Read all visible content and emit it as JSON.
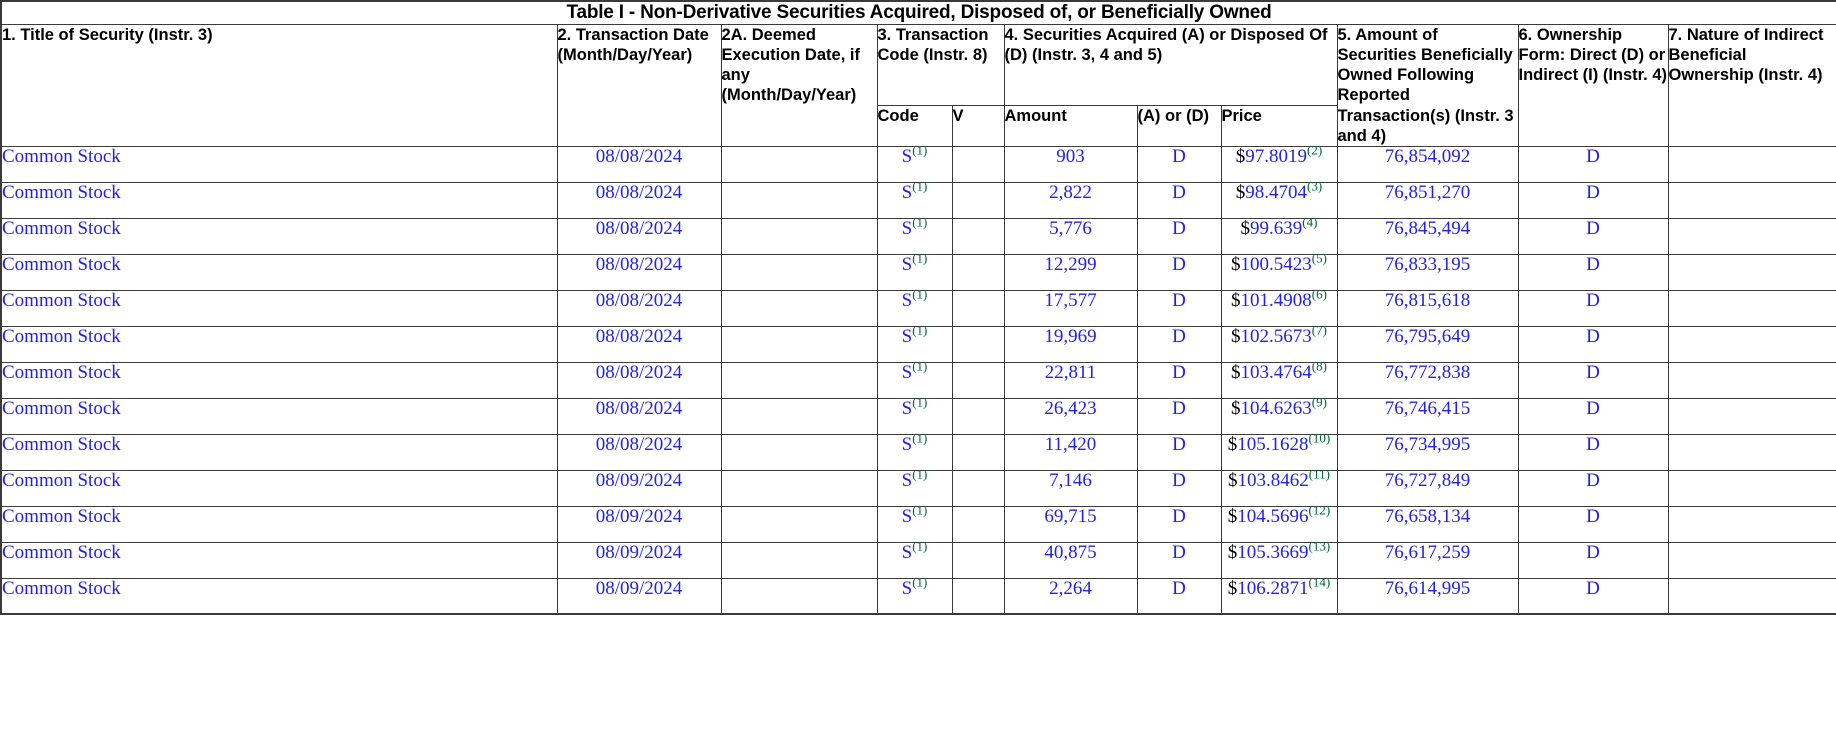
{
  "table": {
    "title": "Table I - Non-Derivative Securities Acquired, Disposed of, or Beneficially Owned",
    "headers": {
      "col1": "1. Title of Security (Instr. 3)",
      "col2": "2. Transaction Date (Month/Day/Year)",
      "col2a": "2A. Deemed Execution Date, if any (Month/Day/Year)",
      "col3": "3. Transaction Code (Instr. 8)",
      "col4": "4. Securities Acquired (A) or Disposed Of (D) (Instr. 3, 4 and 5)",
      "col5": "5. Amount of Securities Beneficially Owned Following Reported Transaction(s) (Instr. 3 and 4)",
      "col6": "6. Ownership Form: Direct (D) or Indirect (I) (Instr. 4)",
      "col7": "7. Nature of Indirect Beneficial Ownership (Instr. 4)"
    },
    "subheaders": {
      "code": "Code",
      "v": "V",
      "amount": "Amount",
      "ad": "(A) or (D)",
      "price": "Price"
    },
    "rows": [
      {
        "security": "Common Stock",
        "transaction_date": "08/08/2024",
        "deemed_execution_date": "",
        "code": "S",
        "code_footnote": "(1)",
        "v": "",
        "amount": "903",
        "ad": "D",
        "price_currency": "$",
        "price": "97.8019",
        "price_footnote": "(2)",
        "beneficially_owned": "76,854,092",
        "ownership_form": "D",
        "nature_indirect": ""
      },
      {
        "security": "Common Stock",
        "transaction_date": "08/08/2024",
        "deemed_execution_date": "",
        "code": "S",
        "code_footnote": "(1)",
        "v": "",
        "amount": "2,822",
        "ad": "D",
        "price_currency": "$",
        "price": "98.4704",
        "price_footnote": "(3)",
        "beneficially_owned": "76,851,270",
        "ownership_form": "D",
        "nature_indirect": ""
      },
      {
        "security": "Common Stock",
        "transaction_date": "08/08/2024",
        "deemed_execution_date": "",
        "code": "S",
        "code_footnote": "(1)",
        "v": "",
        "amount": "5,776",
        "ad": "D",
        "price_currency": "$",
        "price": "99.639",
        "price_footnote": "(4)",
        "beneficially_owned": "76,845,494",
        "ownership_form": "D",
        "nature_indirect": ""
      },
      {
        "security": "Common Stock",
        "transaction_date": "08/08/2024",
        "deemed_execution_date": "",
        "code": "S",
        "code_footnote": "(1)",
        "v": "",
        "amount": "12,299",
        "ad": "D",
        "price_currency": "$",
        "price": "100.5423",
        "price_footnote": "(5)",
        "beneficially_owned": "76,833,195",
        "ownership_form": "D",
        "nature_indirect": ""
      },
      {
        "security": "Common Stock",
        "transaction_date": "08/08/2024",
        "deemed_execution_date": "",
        "code": "S",
        "code_footnote": "(1)",
        "v": "",
        "amount": "17,577",
        "ad": "D",
        "price_currency": "$",
        "price": "101.4908",
        "price_footnote": "(6)",
        "beneficially_owned": "76,815,618",
        "ownership_form": "D",
        "nature_indirect": ""
      },
      {
        "security": "Common Stock",
        "transaction_date": "08/08/2024",
        "deemed_execution_date": "",
        "code": "S",
        "code_footnote": "(1)",
        "v": "",
        "amount": "19,969",
        "ad": "D",
        "price_currency": "$",
        "price": "102.5673",
        "price_footnote": "(7)",
        "beneficially_owned": "76,795,649",
        "ownership_form": "D",
        "nature_indirect": ""
      },
      {
        "security": "Common Stock",
        "transaction_date": "08/08/2024",
        "deemed_execution_date": "",
        "code": "S",
        "code_footnote": "(1)",
        "v": "",
        "amount": "22,811",
        "ad": "D",
        "price_currency": "$",
        "price": "103.4764",
        "price_footnote": "(8)",
        "beneficially_owned": "76,772,838",
        "ownership_form": "D",
        "nature_indirect": ""
      },
      {
        "security": "Common Stock",
        "transaction_date": "08/08/2024",
        "deemed_execution_date": "",
        "code": "S",
        "code_footnote": "(1)",
        "v": "",
        "amount": "26,423",
        "ad": "D",
        "price_currency": "$",
        "price": "104.6263",
        "price_footnote": "(9)",
        "beneficially_owned": "76,746,415",
        "ownership_form": "D",
        "nature_indirect": ""
      },
      {
        "security": "Common Stock",
        "transaction_date": "08/08/2024",
        "deemed_execution_date": "",
        "code": "S",
        "code_footnote": "(1)",
        "v": "",
        "amount": "11,420",
        "ad": "D",
        "price_currency": "$",
        "price": "105.1628",
        "price_footnote": "(10)",
        "beneficially_owned": "76,734,995",
        "ownership_form": "D",
        "nature_indirect": ""
      },
      {
        "security": "Common Stock",
        "transaction_date": "08/09/2024",
        "deemed_execution_date": "",
        "code": "S",
        "code_footnote": "(1)",
        "v": "",
        "amount": "7,146",
        "ad": "D",
        "price_currency": "$",
        "price": "103.8462",
        "price_footnote": "(11)",
        "beneficially_owned": "76,727,849",
        "ownership_form": "D",
        "nature_indirect": ""
      },
      {
        "security": "Common Stock",
        "transaction_date": "08/09/2024",
        "deemed_execution_date": "",
        "code": "S",
        "code_footnote": "(1)",
        "v": "",
        "amount": "69,715",
        "ad": "D",
        "price_currency": "$",
        "price": "104.5696",
        "price_footnote": "(12)",
        "beneficially_owned": "76,658,134",
        "ownership_form": "D",
        "nature_indirect": ""
      },
      {
        "security": "Common Stock",
        "transaction_date": "08/09/2024",
        "deemed_execution_date": "",
        "code": "S",
        "code_footnote": "(1)",
        "v": "",
        "amount": "40,875",
        "ad": "D",
        "price_currency": "$",
        "price": "105.3669",
        "price_footnote": "(13)",
        "beneficially_owned": "76,617,259",
        "ownership_form": "D",
        "nature_indirect": ""
      },
      {
        "security": "Common Stock",
        "transaction_date": "08/09/2024",
        "deemed_execution_date": "",
        "code": "S",
        "code_footnote": "(1)",
        "v": "",
        "amount": "2,264",
        "ad": "D",
        "price_currency": "$",
        "price": "106.2871",
        "price_footnote": "(14)",
        "beneficially_owned": "76,614,995",
        "ownership_form": "D",
        "nature_indirect": ""
      }
    ]
  },
  "colors": {
    "value_blue": "#2323dd",
    "footnote_green": "#006633",
    "border": "#3a3a3a",
    "text_black": "#000000"
  }
}
